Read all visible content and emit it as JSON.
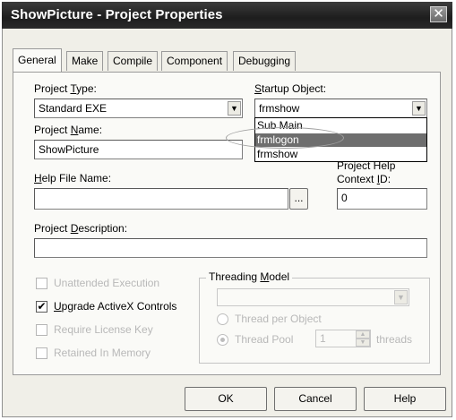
{
  "window": {
    "title": "ShowPicture - Project Properties",
    "close_glyph": "✕"
  },
  "tabs": [
    {
      "label": "General",
      "active": true
    },
    {
      "label": "Make"
    },
    {
      "label": "Compile"
    },
    {
      "label": "Component"
    },
    {
      "label": "Debugging"
    }
  ],
  "general": {
    "project_type": {
      "label_pre": "Project ",
      "label_key": "T",
      "label_post": "ype:",
      "value": "Standard EXE"
    },
    "startup_object": {
      "label_key": "S",
      "label_post": "tartup Object:",
      "value": "frmshow"
    },
    "startup_options": [
      "Sub Main",
      "frmlogon",
      "frmshow"
    ],
    "startup_selected_index": 1,
    "project_name": {
      "label_pre": "Project ",
      "label_key": "N",
      "label_post": "ame:",
      "value": "ShowPicture"
    },
    "help_file": {
      "label_key": "H",
      "label_post": "elp File Name:",
      "value": "",
      "browse_label": "..."
    },
    "help_context": {
      "label_line1": "Project Help",
      "label_pre": "Context ",
      "label_key": "I",
      "label_post": "D:",
      "value": "0"
    },
    "description": {
      "label_pre": "Project ",
      "label_key": "D",
      "label_post": "escription:",
      "value": ""
    },
    "unattended_execution": {
      "label": "Unattended Execution",
      "checked": false,
      "enabled": false
    },
    "upgrade_activex": {
      "label_key": "U",
      "label_post": "pgrade ActiveX Controls",
      "checked": true,
      "enabled": true
    },
    "require_license": {
      "label": "Require License Key",
      "checked": false,
      "enabled": false
    },
    "retained_in_memory": {
      "label": "Retained In Memory",
      "checked": false,
      "enabled": false
    },
    "threading_model": {
      "label_pre": "Threading ",
      "label_key": "M",
      "label_post": "odel",
      "value": "",
      "threads_per_object_label": "Thread per Object",
      "thread_pool_label": "Thread Pool",
      "thread_pool_count": "1",
      "threads_suffix": "threads"
    }
  },
  "buttons": {
    "ok": "OK",
    "cancel": "Cancel",
    "help": "Help"
  },
  "colors": {
    "titlebar": "#2a2a2a",
    "selection": "#6e6e6e",
    "dialog_bg": "#f0efe8"
  }
}
